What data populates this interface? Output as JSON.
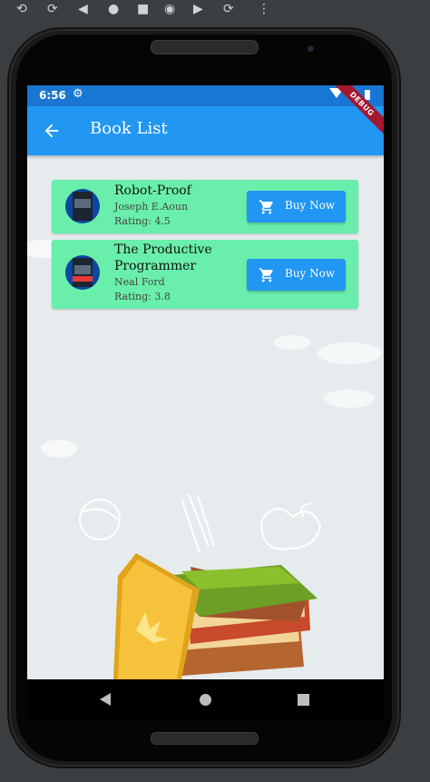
{
  "status_bar": {
    "time": "6:56"
  },
  "app_bar": {
    "title": "Book List",
    "debug_banner": "DEBUG"
  },
  "books": [
    {
      "title": "Robot-Proof",
      "author": "Joseph E.Aoun",
      "rating": "Rating: 4.5",
      "buy_label": "Buy Now"
    },
    {
      "title": "The Productive Programmer",
      "author": "Neal Ford",
      "rating": "Rating: 3.8",
      "buy_label": "Buy Now"
    }
  ],
  "colors": {
    "app_bar": "#2196f3",
    "status_bar": "#1976d2",
    "card": "#69efab",
    "button": "#2196f3"
  },
  "icons": [
    "back-arrow-icon",
    "settings-icon",
    "wifi-icon",
    "battery-icon",
    "cart-icon"
  ]
}
